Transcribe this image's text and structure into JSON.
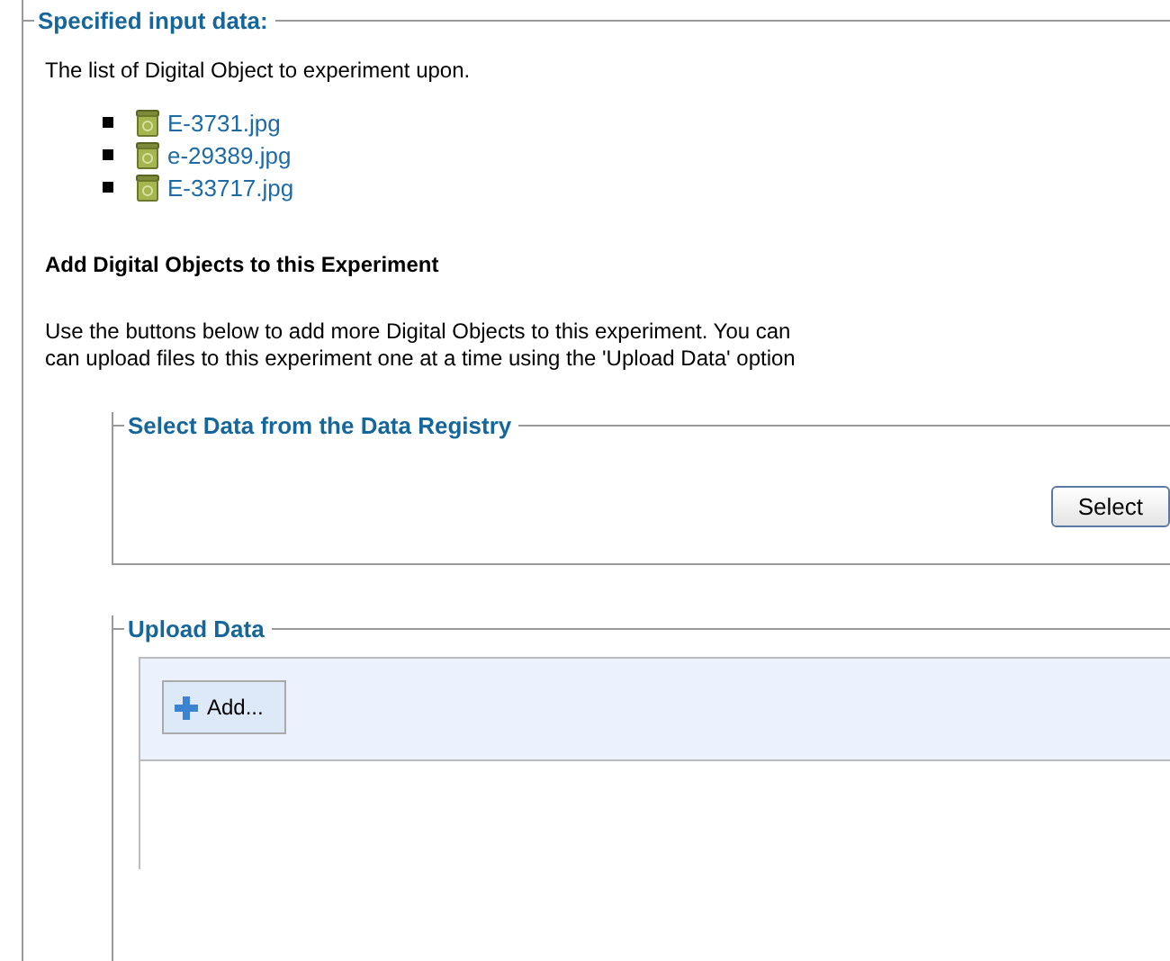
{
  "input_section": {
    "legend": "Specified input data:",
    "intro": "The list of Digital Object to experiment upon.",
    "objects": [
      {
        "name": "E-3731.jpg"
      },
      {
        "name": "e-29389.jpg"
      },
      {
        "name": "E-33717.jpg"
      }
    ]
  },
  "add_section": {
    "heading": "Add Digital Objects to this Experiment",
    "lines": [
      "Use the buttons below to add more Digital Objects to this experiment. You can",
      "can upload files to this experiment one at a time using the 'Upload Data' option"
    ]
  },
  "registry": {
    "legend": "Select Data from the Data Registry",
    "button": "Select"
  },
  "upload": {
    "legend": "Upload Data",
    "button": "Add..."
  }
}
